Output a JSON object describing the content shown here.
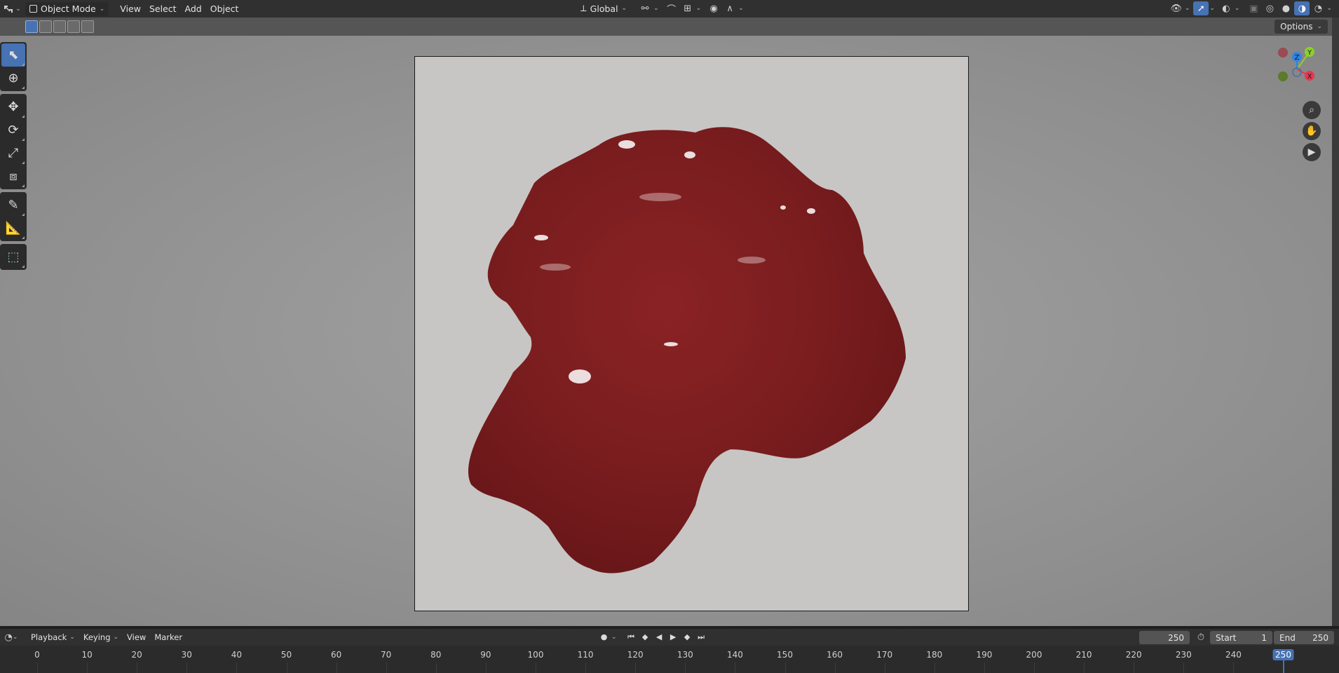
{
  "header": {
    "editor_icon": "editor-type-icon",
    "mode": "Object Mode",
    "menus": [
      "View",
      "Select",
      "Add",
      "Object"
    ],
    "transform_orientation": "Global"
  },
  "toolheader": {
    "options_label": "Options"
  },
  "toolbar": {
    "tools": [
      {
        "name": "select-box-tool",
        "icon": "cursor-icon",
        "active": true
      },
      {
        "name": "cursor-tool",
        "icon": "crosshair-icon",
        "active": false
      },
      {
        "name": "move-tool",
        "icon": "move-icon",
        "active": false
      },
      {
        "name": "rotate-tool",
        "icon": "rotate-icon",
        "active": false
      },
      {
        "name": "scale-tool",
        "icon": "scale-icon",
        "active": false
      },
      {
        "name": "transform-tool",
        "icon": "transform-icon",
        "active": false
      },
      {
        "name": "annotate-tool",
        "icon": "pencil-icon",
        "active": false
      },
      {
        "name": "measure-tool",
        "icon": "ruler-icon",
        "active": false
      },
      {
        "name": "add-cube-tool",
        "icon": "cube-icon",
        "active": false
      }
    ]
  },
  "gizmo": {
    "axes": [
      "X",
      "Y",
      "Z"
    ],
    "colors": {
      "x": "#e8364f",
      "y": "#8bd02b",
      "z": "#2f83e6"
    }
  },
  "viewport": {
    "blob_color": "#7c1e20",
    "background_color": "#c7c6c4"
  },
  "timeline": {
    "menus": [
      "Playback",
      "Keying",
      "View",
      "Marker"
    ],
    "current_frame": "250",
    "start_label": "Start",
    "start_value": "1",
    "end_label": "End",
    "end_value": "250",
    "ticks": [
      "0",
      "10",
      "20",
      "30",
      "40",
      "50",
      "60",
      "70",
      "80",
      "90",
      "100",
      "110",
      "120",
      "130",
      "140",
      "150",
      "160",
      "170",
      "180",
      "190",
      "200",
      "210",
      "220",
      "230",
      "240",
      "250"
    ]
  }
}
